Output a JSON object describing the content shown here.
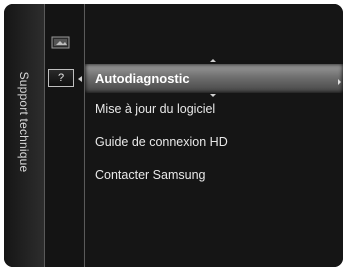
{
  "sidebar": {
    "title": "Support technique"
  },
  "icons": [
    {
      "name": "picture-settings-icon"
    },
    {
      "name": "help-icon",
      "glyph": "?"
    }
  ],
  "menu": {
    "items": [
      {
        "label": "Autodiagnostic",
        "selected": true
      },
      {
        "label": "Mise à jour du logiciel"
      },
      {
        "label": "Guide de connexion HD"
      },
      {
        "label": "Contacter Samsung"
      }
    ]
  },
  "colors": {
    "background": "#151515",
    "highlight": "#8a8a8a",
    "text": "#e8e8e8"
  }
}
